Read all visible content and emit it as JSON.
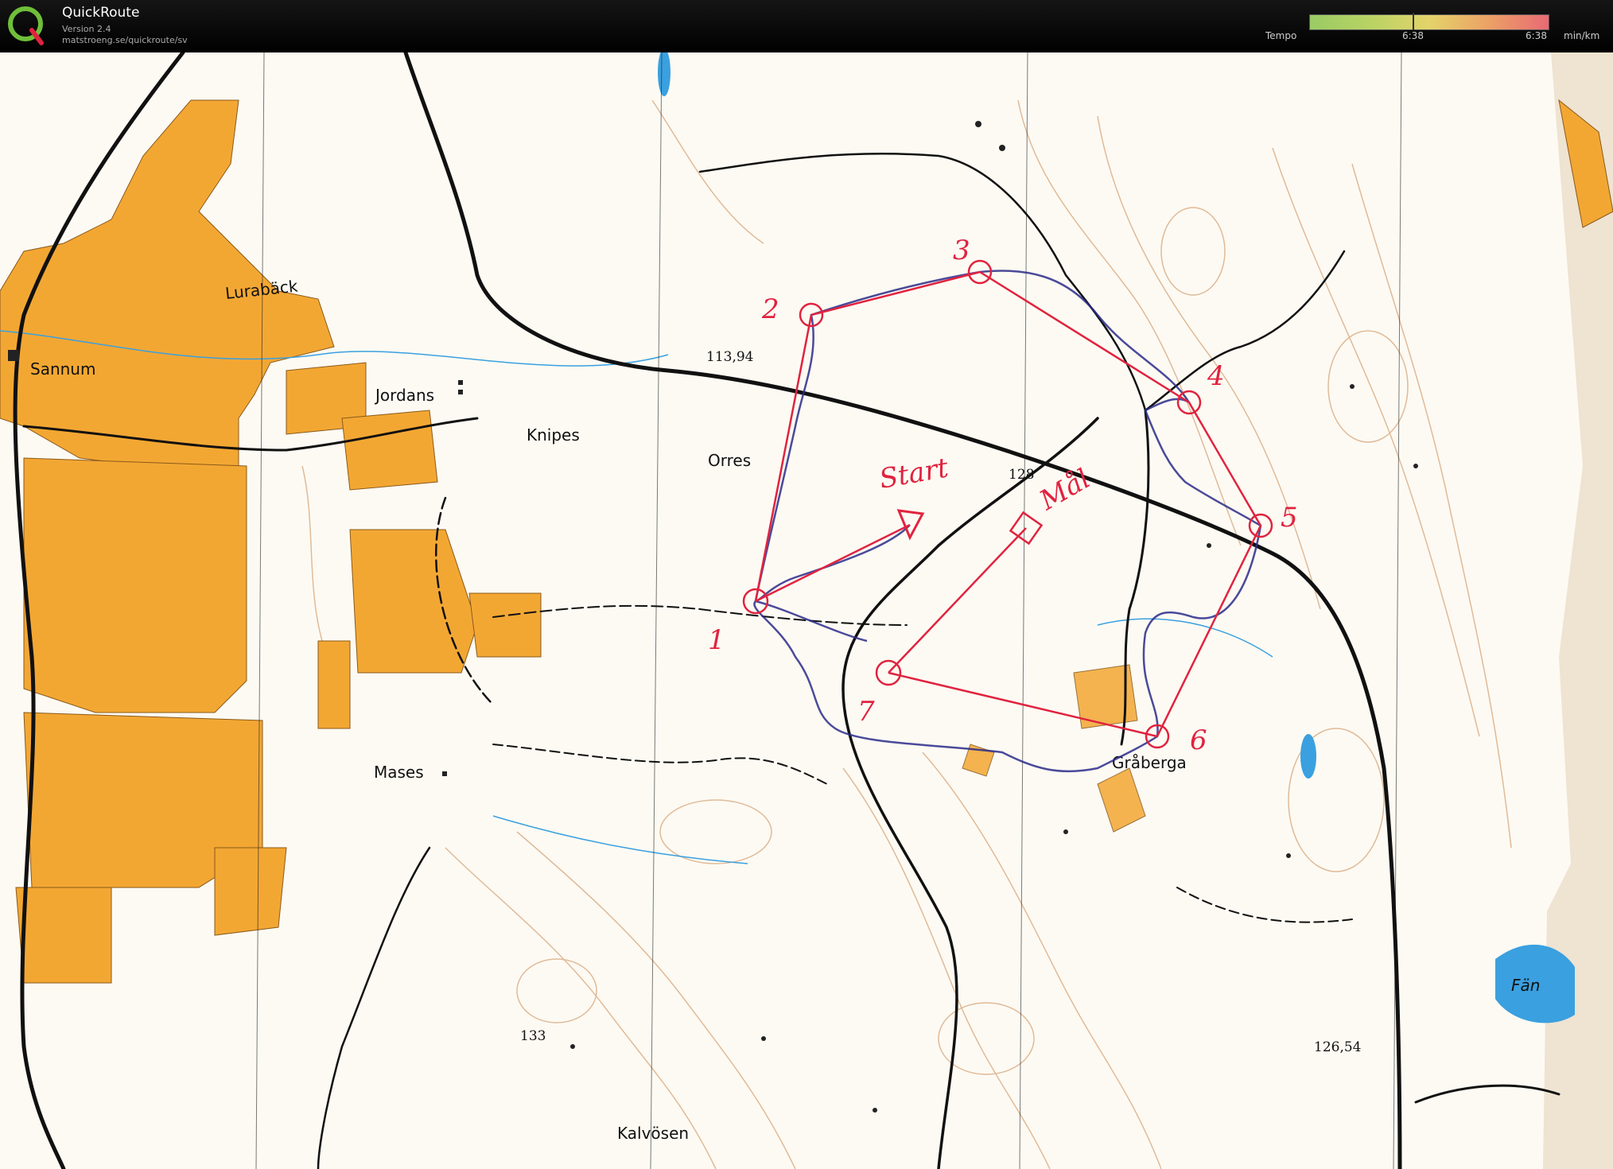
{
  "header": {
    "app_title": "QuickRoute",
    "version": "Version 2.4",
    "url": "matstroeng.se/quickroute/sv",
    "tempo_label": "Tempo",
    "tempo_mid": "6:38",
    "tempo_right": "6:38",
    "tempo_unit": "min/km"
  },
  "colors": {
    "field": "#f3a733",
    "contour": "#c8874f",
    "road": "#111111",
    "water": "#3aa0e0",
    "course": "#e0233f",
    "route": "#2a2a8a"
  },
  "map": {
    "places": {
      "lurabäck": "Lurabäck",
      "sannum": "Sannum",
      "jordans": "Jordans",
      "knipes": "Knipes",
      "orres": "Orres",
      "mases": "Mases",
      "graberga": "Gråberga",
      "kalvosen": "Kalvösen",
      "fan": "Fän"
    },
    "heights": {
      "h1": "113,94",
      "h2": "128",
      "h3": "133",
      "h4": "126,54"
    },
    "course_labels": {
      "start": "Start",
      "finish": "Mål",
      "c1": "1",
      "c2": "2",
      "c3": "3",
      "c4": "4",
      "c5": "5",
      "c6": "6",
      "c7": "7"
    }
  }
}
